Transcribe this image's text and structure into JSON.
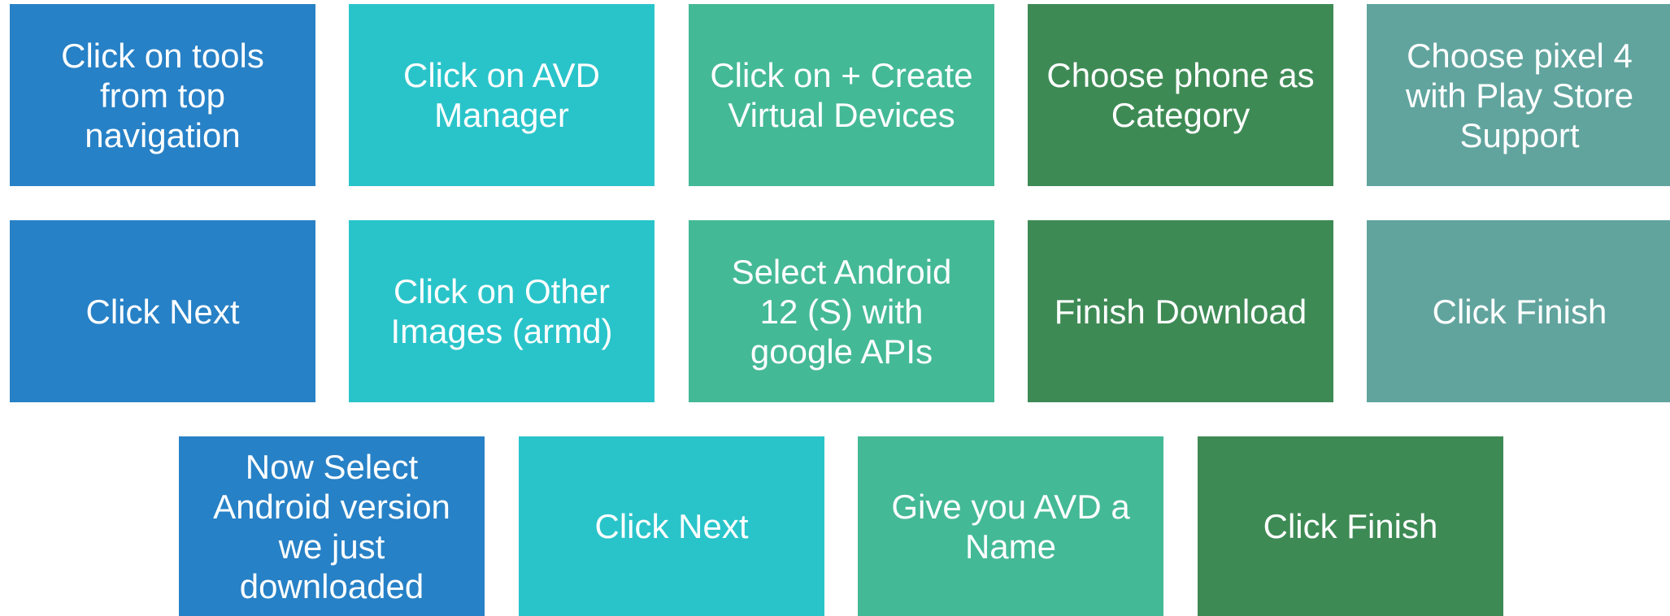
{
  "colors": {
    "blue": "#2781C6",
    "cyan": "#29C4CA",
    "green": "#44B996",
    "dark_green": "#3E8A55",
    "gray_teal": "#61A49E"
  },
  "steps": [
    {
      "label": "Click on tools\nfrom top\nnavigation",
      "color": "#2781C6"
    },
    {
      "label": "Click on AVD\nManager",
      "color": "#29C4CA"
    },
    {
      "label": "Click on + Create\nVirtual Devices",
      "color": "#44B996"
    },
    {
      "label": "Choose phone as\nCategory",
      "color": "#3E8A55"
    },
    {
      "label": "Choose pixel 4\nwith Play Store\nSupport",
      "color": "#61A49E"
    },
    {
      "label": "Click Next",
      "color": "#2781C6"
    },
    {
      "label": "Click on Other\nImages (armd)",
      "color": "#29C4CA"
    },
    {
      "label": "Select Android\n12 (S) with\ngoogle APIs",
      "color": "#44B996"
    },
    {
      "label": "Finish Download",
      "color": "#3E8A55"
    },
    {
      "label": "Click Finish",
      "color": "#61A49E"
    },
    {
      "label": "Now Select\nAndroid version\nwe just\ndownloaded",
      "color": "#2781C6"
    },
    {
      "label": "Click Next",
      "color": "#29C4CA"
    },
    {
      "label": "Give you AVD a\nName",
      "color": "#44B996"
    },
    {
      "label": "Click Finish",
      "color": "#3E8A55"
    }
  ]
}
